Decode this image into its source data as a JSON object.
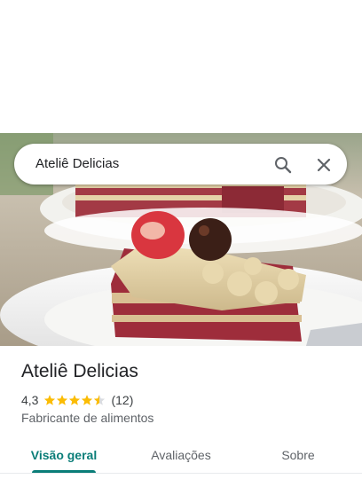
{
  "search": {
    "query": "Ateliê Delicias"
  },
  "icons": {
    "search": "search-icon",
    "close": "close-icon",
    "star": "star-icon",
    "half_star": "half-star-icon"
  },
  "place": {
    "name": "Ateliê Delicias",
    "rating": "4,3",
    "stars_value": 4.3,
    "review_count": "(12)",
    "category": "Fabricante de alimentos"
  },
  "tabs": [
    {
      "label": "Visão geral",
      "active": true
    },
    {
      "label": "Avaliações",
      "active": false
    },
    {
      "label": "Sobre",
      "active": false
    }
  ],
  "colors": {
    "accent": "#0a7d78",
    "star": "#fbbc04"
  }
}
